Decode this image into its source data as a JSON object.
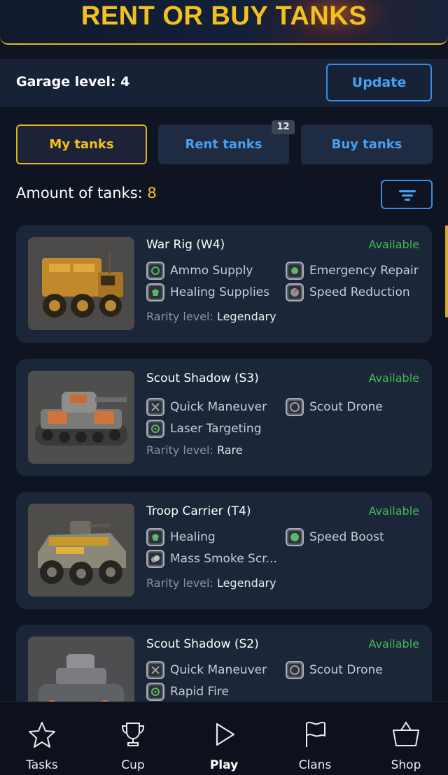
{
  "banner": {
    "title": "RENT OR BUY TANKS"
  },
  "garage": {
    "label": "Garage level: 4",
    "update_label": "Update"
  },
  "tabs": [
    {
      "label": "My tanks",
      "active": true
    },
    {
      "label": "Rent tanks",
      "badge": "12"
    },
    {
      "label": "Buy tanks"
    }
  ],
  "amount": {
    "label": "Amount of tanks: ",
    "value": "8"
  },
  "filter": {
    "icon": "filter-icon"
  },
  "rarity_label": "Rarity level:",
  "tanks": [
    {
      "name": "War Rig (W4)",
      "status": "Available",
      "skills": [
        "Ammo Supply",
        "Emergency Repair",
        "Healing Supplies",
        "Speed Reduction"
      ],
      "rarity": "Legendary"
    },
    {
      "name": "Scout Shadow (S3)",
      "status": "Available",
      "skills": [
        "Quick Maneuver",
        "Scout Drone",
        "Laser Targeting"
      ],
      "rarity": "Rare"
    },
    {
      "name": "Troop Carrier (T4)",
      "status": "Available",
      "skills": [
        "Healing",
        "Speed Boost",
        "Mass Smoke Scr..."
      ],
      "rarity": "Legendary"
    },
    {
      "name": "Scout Shadow (S2)",
      "status": "Available",
      "skills": [
        "Quick Maneuver",
        "Scout Drone",
        "Rapid Fire"
      ],
      "rarity": ""
    }
  ],
  "nav": [
    {
      "label": "Tasks",
      "icon": "star-icon"
    },
    {
      "label": "Cup",
      "icon": "trophy-icon"
    },
    {
      "label": "Play",
      "icon": "play-icon",
      "active": true
    },
    {
      "label": "Clans",
      "icon": "flag-icon"
    },
    {
      "label": "Shop",
      "icon": "basket-icon"
    }
  ],
  "colors": {
    "accent_gold": "#f2c21c",
    "accent_blue": "#47a0f2",
    "status_green": "#45b85a",
    "background": "#0e1422"
  }
}
